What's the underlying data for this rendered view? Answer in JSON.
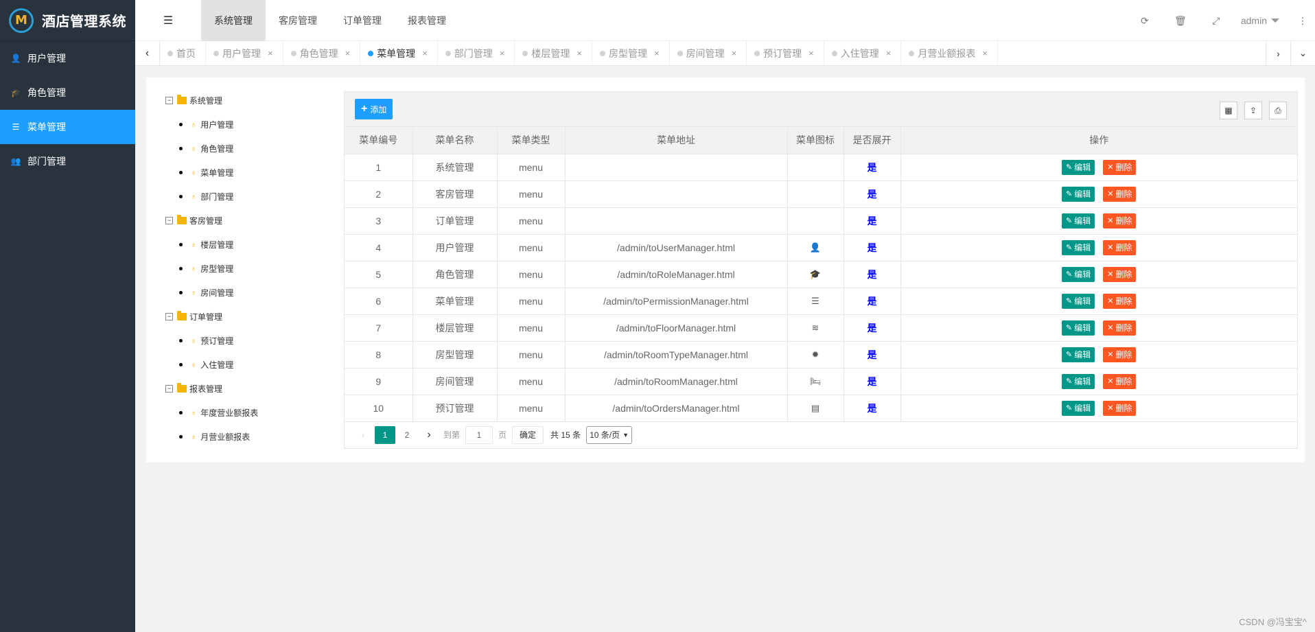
{
  "app": {
    "title": "酒店管理系统",
    "logo_letter": "M"
  },
  "sidebar": {
    "items": [
      {
        "label": "用户管理",
        "icon": "user-icon",
        "glyph": "👤",
        "active": false
      },
      {
        "label": "角色管理",
        "icon": "role-icon",
        "glyph": "🎓",
        "active": false
      },
      {
        "label": "菜单管理",
        "icon": "list-icon",
        "glyph": "☰",
        "active": true
      },
      {
        "label": "部门管理",
        "icon": "group-icon",
        "glyph": "👥",
        "active": false
      }
    ]
  },
  "header": {
    "tabs": [
      "系统管理",
      "客房管理",
      "订单管理",
      "报表管理"
    ],
    "active_tab": 0,
    "user": "admin"
  },
  "tabbar": {
    "tabs": [
      {
        "label": "首页",
        "closable": false,
        "active": false
      },
      {
        "label": "用户管理",
        "closable": true,
        "active": false
      },
      {
        "label": "角色管理",
        "closable": true,
        "active": false
      },
      {
        "label": "菜单管理",
        "closable": true,
        "active": true
      },
      {
        "label": "部门管理",
        "closable": true,
        "active": false
      },
      {
        "label": "楼层管理",
        "closable": true,
        "active": false
      },
      {
        "label": "房型管理",
        "closable": true,
        "active": false
      },
      {
        "label": "房间管理",
        "closable": true,
        "active": false
      },
      {
        "label": "预订管理",
        "closable": true,
        "active": false
      },
      {
        "label": "入住管理",
        "closable": true,
        "active": false
      },
      {
        "label": "月营业额报表",
        "closable": true,
        "active": false
      }
    ]
  },
  "tree": [
    {
      "label": "系统管理",
      "children": [
        "用户管理",
        "角色管理",
        "菜单管理",
        "部门管理"
      ]
    },
    {
      "label": "客房管理",
      "children": [
        "楼层管理",
        "房型管理",
        "房间管理"
      ]
    },
    {
      "label": "订单管理",
      "children": [
        "预订管理",
        "入住管理"
      ]
    },
    {
      "label": "报表管理",
      "children": [
        "年度营业额报表",
        "月营业额报表"
      ]
    }
  ],
  "toolbar": {
    "add_label": "添加"
  },
  "table": {
    "headers": [
      "菜单编号",
      "菜单名称",
      "菜单类型",
      "菜单地址",
      "菜单图标",
      "是否展开",
      "操作"
    ],
    "edit_label": "编辑",
    "delete_label": "删除",
    "rows": [
      {
        "id": "1",
        "name": "系统管理",
        "type": "menu",
        "url": "",
        "icon": "",
        "glyph": "",
        "expand": "是"
      },
      {
        "id": "2",
        "name": "客房管理",
        "type": "menu",
        "url": "",
        "icon": "",
        "glyph": "",
        "expand": "是"
      },
      {
        "id": "3",
        "name": "订单管理",
        "type": "menu",
        "url": "",
        "icon": "",
        "glyph": "",
        "expand": "是"
      },
      {
        "id": "4",
        "name": "用户管理",
        "type": "menu",
        "url": "/admin/toUserManager.html",
        "icon": "user-icon",
        "glyph": "👤",
        "expand": "是"
      },
      {
        "id": "5",
        "name": "角色管理",
        "type": "menu",
        "url": "/admin/toRoleManager.html",
        "icon": "role-icon",
        "glyph": "🎓",
        "expand": "是"
      },
      {
        "id": "6",
        "name": "菜单管理",
        "type": "menu",
        "url": "/admin/toPermissionManager.html",
        "icon": "list-icon",
        "glyph": "☰",
        "expand": "是"
      },
      {
        "id": "7",
        "name": "楼层管理",
        "type": "menu",
        "url": "/admin/toFloorManager.html",
        "icon": "stack-icon",
        "glyph": "≋",
        "expand": "是"
      },
      {
        "id": "8",
        "name": "房型管理",
        "type": "menu",
        "url": "/admin/toRoomTypeManager.html",
        "icon": "gear-icon",
        "glyph": "✹",
        "expand": "是"
      },
      {
        "id": "9",
        "name": "房间管理",
        "type": "menu",
        "url": "/admin/toRoomManager.html",
        "icon": "bed-icon",
        "glyph": "🛏",
        "expand": "是"
      },
      {
        "id": "10",
        "name": "预订管理",
        "type": "menu",
        "url": "/admin/toOrdersManager.html",
        "icon": "card-icon",
        "glyph": "▤",
        "expand": "是"
      }
    ]
  },
  "pager": {
    "pages": [
      "1",
      "2"
    ],
    "current": "1",
    "goto_label": "到第",
    "page_value": "1",
    "page_unit": "页",
    "confirm_label": "确定",
    "total_label": "共 15 条",
    "page_size": "10 条/页"
  },
  "watermark": "CSDN @冯宝宝^"
}
